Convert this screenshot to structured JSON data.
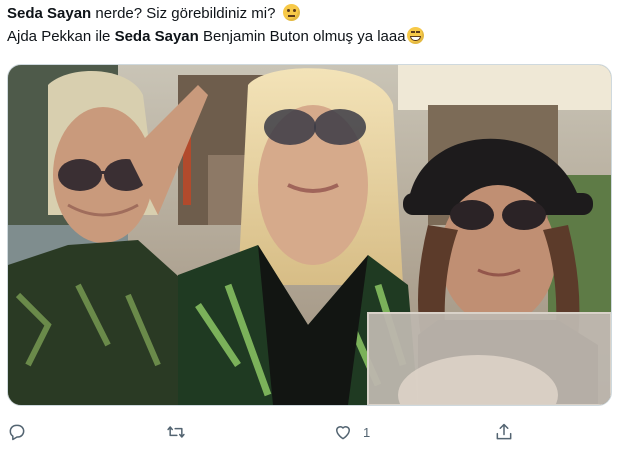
{
  "tweet": {
    "line1": {
      "name": "Seda Sayan",
      "rest": " nerde? Siz görebildiniz mi?"
    },
    "line2": {
      "prefix": "Ajda Pekkan ile ",
      "name": "Seda Sayan",
      "suffix": " Benjamin Buton olmuş ya laaa"
    }
  },
  "icons": {
    "emoji1": "face-with-rolling-eyes-emoji",
    "emoji2": "grinning-squinting-face-emoji"
  },
  "actions": {
    "reply": {
      "icon": "reply-icon"
    },
    "retweet": {
      "icon": "retweet-icon"
    },
    "like": {
      "icon": "heart-icon",
      "count": "1"
    },
    "share": {
      "icon": "share-icon"
    }
  },
  "colors": {
    "text": "#0f1419",
    "secondary": "#536471",
    "border": "#cfd9de"
  }
}
